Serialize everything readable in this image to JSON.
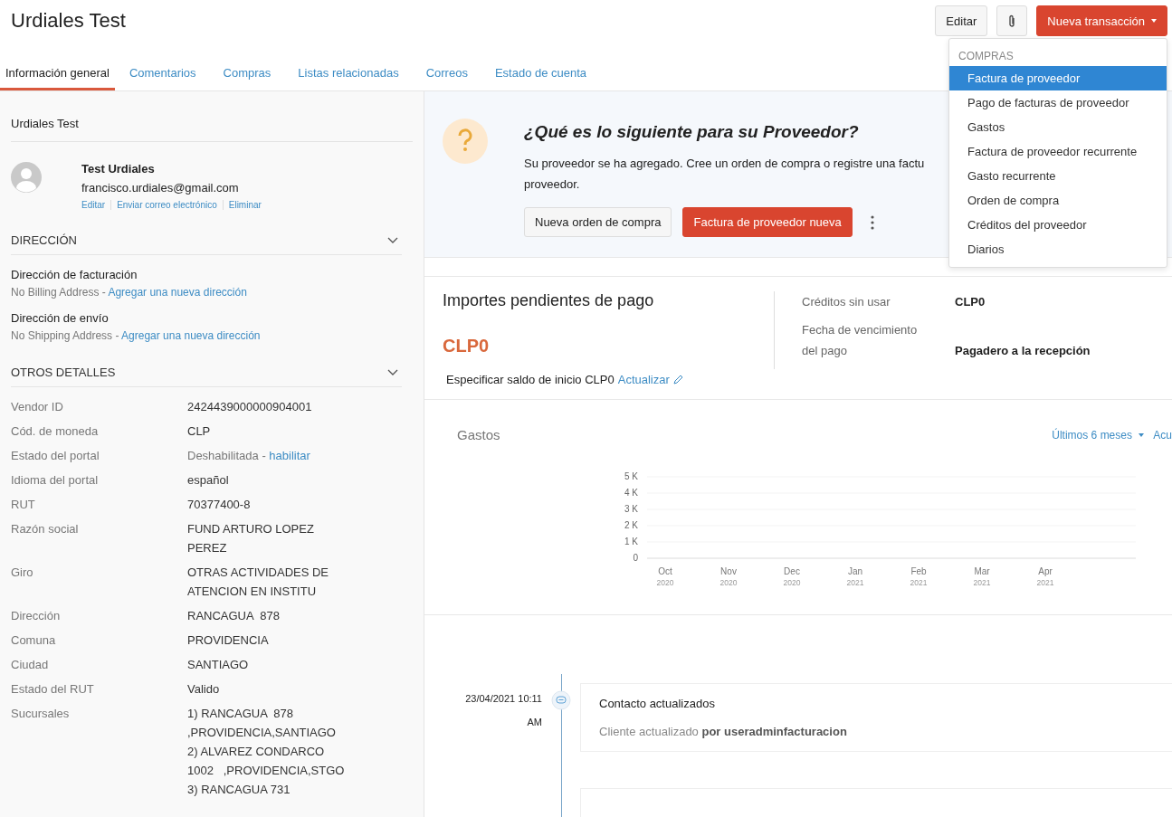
{
  "header": {
    "title": "Urdiales Test",
    "buttons": [
      {
        "kind": "plain",
        "label": "Editar"
      },
      {
        "kind": "attach"
      },
      {
        "kind": "primary",
        "label": "Nueva transacción"
      }
    ]
  },
  "tabs": [
    {
      "label": "Información general",
      "selected": true
    },
    {
      "label": "Comentarios",
      "selected": false
    },
    {
      "label": "Compras",
      "selected": false
    },
    {
      "label": "Listas relacionadas",
      "selected": false
    },
    {
      "label": "Correos",
      "selected": false
    },
    {
      "label": "Estado de cuenta",
      "selected": false
    }
  ],
  "sidebar": {
    "name": "Urdiales Test",
    "contact": {
      "name": "Test Urdiales",
      "email": "francisco.urdiales@gmail.com",
      "links": [
        "Editar",
        "Enviar correo electrónico",
        "Eliminar"
      ]
    },
    "address_section": "DIRECCIÓN",
    "addresses": [
      {
        "label": "Dirección de facturación",
        "value": "No Billing Address -",
        "link": "Agregar una nueva dirección"
      },
      {
        "label": "Dirección de envío",
        "value": "No Shipping Address -",
        "link": "Agregar una nueva dirección"
      }
    ],
    "details_section": "OTROS DETALLES",
    "details": [
      {
        "label": "Vendor ID",
        "lines": [
          "2424439000000904001"
        ]
      },
      {
        "label": "Cód. de moneda",
        "lines": [
          "CLP"
        ]
      },
      {
        "label": "Estado del portal",
        "muted": "Deshabilitada -",
        "link": "habilitar"
      },
      {
        "label": "Idioma del portal",
        "lines": [
          "español"
        ]
      },
      {
        "label": "RUT",
        "lines": [
          "70377400-8"
        ]
      },
      {
        "label": "Razón social",
        "lines": [
          "FUND ARTURO LOPEZ",
          "PEREZ"
        ]
      },
      {
        "label": "Giro",
        "lines": [
          "OTRAS ACTIVIDADES DE",
          "ATENCION EN INSTITU"
        ]
      },
      {
        "label": "Dirección",
        "lines": [
          "RANCAGUA  878"
        ]
      },
      {
        "label": "Comuna",
        "lines": [
          "PROVIDENCIA"
        ]
      },
      {
        "label": "Ciudad",
        "lines": [
          "SANTIAGO"
        ]
      },
      {
        "label": "Estado del RUT",
        "lines": [
          "Valido"
        ]
      },
      {
        "label": "Sucursales",
        "lines": [
          "1) RANCAGUA  878",
          ",PROVIDENCIA,SANTIAGO",
          "2) ALVAREZ CONDARCO",
          "1002   ,PROVIDENCIA,STGO",
          "3) RANCAGUA 731"
        ]
      }
    ]
  },
  "next_steps": {
    "title": "¿Qué es lo siguiente para su Proveedor?",
    "lines": [
      "Su proveedor se ha agregado. Cree un orden de compra o registre una factu",
      "proveedor."
    ],
    "buttons": [
      {
        "kind": "plain",
        "label": "Nueva orden de compra"
      },
      {
        "kind": "primary",
        "label": "Factura de proveedor nueva"
      }
    ]
  },
  "payables": {
    "title": "Importes pendientes de pago",
    "amount": "CLP0",
    "facts": [
      {
        "label": "Créditos sin usar",
        "value": "CLP0"
      },
      {
        "label": "Fecha de vencimiento del pago",
        "value": "Pagadero a la recepción"
      }
    ],
    "opening_text": "Especificar saldo de inicio CLP0",
    "opening_link": "Actualizar"
  },
  "expenses": {
    "title": "Gastos",
    "period": "Últimos 6 meses",
    "extra": "Acu",
    "chart_data": {
      "type": "bar",
      "categories": [
        "Oct 2020",
        "Nov 2020",
        "Dec 2020",
        "Jan 2021",
        "Feb 2021",
        "Mar 2021",
        "Apr 2021"
      ],
      "values": [
        0,
        0,
        0,
        0,
        0,
        0,
        0
      ],
      "grid": true,
      "ylim": [
        0,
        5000
      ],
      "yticks": [
        {
          "value": 0,
          "label": "0"
        },
        {
          "value": 1000,
          "label": "1 K"
        },
        {
          "value": 2000,
          "label": "2 K"
        },
        {
          "value": 3000,
          "label": "3 K"
        },
        {
          "value": 4000,
          "label": "4 K"
        },
        {
          "value": 5000,
          "label": "5 K"
        }
      ]
    }
  },
  "timeline": [
    {
      "date": "23/04/2021 10:11",
      "time": "AM",
      "title": "Contacto actualizados",
      "text": "Cliente actualizado **por useradminfacturacion**"
    }
  ],
  "menu": {
    "heading": "COMPRAS",
    "items": [
      {
        "label": "Factura de proveedor",
        "selected": true
      },
      {
        "label": "Pago de facturas de proveedor",
        "selected": false
      },
      {
        "label": "Gastos",
        "selected": false
      },
      {
        "label": "Factura de proveedor recurrente",
        "selected": false
      },
      {
        "label": "Gasto recurrente",
        "selected": false
      },
      {
        "label": "Orden de compra",
        "selected": false
      },
      {
        "label": "Créditos del proveedor",
        "selected": false
      },
      {
        "label": "Diarios",
        "selected": false
      }
    ]
  }
}
